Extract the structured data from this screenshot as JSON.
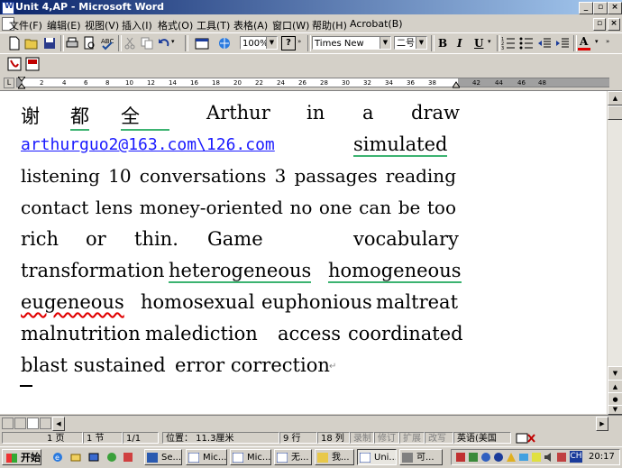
{
  "window": {
    "title": "Unit 4,AP - Microsoft Word"
  },
  "menu": [
    "文件(F)",
    "编辑(E)",
    "视图(V)",
    "插入(I)",
    "格式(O)",
    "工具(T)",
    "表格(A)",
    "窗口(W)",
    "帮助(H)",
    "Acrobat(B)"
  ],
  "toolbar": {
    "zoom": "100%",
    "font_name": "Times New Roman",
    "font_size": "二号",
    "bold": "B",
    "italic": "I",
    "underline": "U",
    "font_color": "A",
    "help": "?"
  },
  "ruler": {
    "ticks": [
      "2",
      "4",
      "6",
      "8",
      "10",
      "12",
      "14",
      "16",
      "18",
      "20",
      "22",
      "24",
      "26",
      "28",
      "30",
      "32",
      "34",
      "36",
      "38",
      "42",
      "44",
      "46",
      "48"
    ]
  },
  "document": {
    "lines": [
      [
        "谢",
        "都",
        "全",
        "Arthur",
        "in",
        "a",
        "draw"
      ],
      [
        "arthurguo2@163.com\\126.com",
        "simulated"
      ],
      [
        "listening 10 conversations 3 passages reading"
      ],
      [
        "contact lens money-oriented no one can be too"
      ],
      [
        "rich",
        "or",
        "thin.",
        "Game",
        "vocabulary"
      ],
      [
        "transformation",
        "heterogeneous",
        "homogeneous"
      ],
      [
        "eugeneous",
        "homosexual",
        "euphonious",
        "maltreat"
      ],
      [
        "malnutrition",
        "malediction",
        "access",
        "coordinated"
      ],
      [
        "blast sustained",
        "error correction"
      ]
    ]
  },
  "status": {
    "page": "1 页",
    "section": "1 节",
    "pages": "1/1",
    "position": "位置： 11.3厘米",
    "row": "9 行",
    "col": "18 列",
    "rec": "录制",
    "trk": "修订",
    "ext": "扩展",
    "ovr": "改写",
    "language": "英语(美国"
  },
  "taskbar": {
    "start": "开始",
    "tasks": [
      "Se...",
      "Mic...",
      "Mic...",
      "无...",
      "我...",
      "Uni...",
      "可..."
    ],
    "tray_ime": "CH",
    "clock": "20:17"
  },
  "colors": {
    "title_start": "#0a246a",
    "title_end": "#a6caf0",
    "link": "#1a1aff",
    "squiggle_green": "#3cb371",
    "squiggle_red": "#e00000",
    "font_color_bar": "#e00000"
  }
}
